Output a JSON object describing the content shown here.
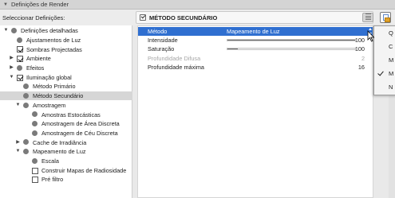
{
  "window": {
    "title": "Definições de Render"
  },
  "selector": {
    "label": "Seleccionar Definições:",
    "value": "MÉTODO SECUNDÁRIO"
  },
  "tree": {
    "items": [
      {
        "label": "Definições detalhadas",
        "twisty": "▼",
        "marker": "bullet",
        "level": 0
      },
      {
        "label": "Ajustamentos de Luz",
        "twisty": "",
        "marker": "bullet",
        "level": 1
      },
      {
        "label": "Sombras Projectadas",
        "twisty": "",
        "marker": "checkbox-on",
        "level": 1
      },
      {
        "label": "Ambiente",
        "twisty": "▶",
        "marker": "checkbox-on",
        "level": 1
      },
      {
        "label": "Efeitos",
        "twisty": "▶",
        "marker": "bullet",
        "level": 1
      },
      {
        "label": "Iluminação global",
        "twisty": "▼",
        "marker": "checkbox-on",
        "level": 1
      },
      {
        "label": "Método Primário",
        "twisty": "",
        "marker": "bullet",
        "level": 2
      },
      {
        "label": "Método Secundário",
        "twisty": "",
        "marker": "bullet",
        "level": 2,
        "selected": true
      },
      {
        "label": "Amostragem",
        "twisty": "▼",
        "marker": "bullet",
        "level": 2
      },
      {
        "label": "Amostras Estocásticas",
        "twisty": "",
        "marker": "bullet",
        "level": 3
      },
      {
        "label": "Amostragem de Área Discreta",
        "twisty": "",
        "marker": "bullet",
        "level": 3
      },
      {
        "label": "Amostragem de Céu Discreta",
        "twisty": "",
        "marker": "bullet",
        "level": 3
      },
      {
        "label": "Cache de Irradiância",
        "twisty": "▶",
        "marker": "bullet",
        "level": 2
      },
      {
        "label": "Mapeamento de Luz",
        "twisty": "▼",
        "marker": "bullet",
        "level": 2
      },
      {
        "label": "Escala",
        "twisty": "",
        "marker": "bullet",
        "level": 3
      },
      {
        "label": "Construir Mapas de Radiosidade",
        "twisty": "",
        "marker": "checkbox-off",
        "level": 3
      },
      {
        "label": "Pré filtro",
        "twisty": "",
        "marker": "checkbox-off",
        "level": 3
      }
    ]
  },
  "properties": [
    {
      "label": "Método",
      "value": "Mapeamento de Luz",
      "highlighted": true
    },
    {
      "label": "Intensidade",
      "value": "100",
      "slider": 1.0
    },
    {
      "label": "Saturação",
      "value": "100",
      "slider": 0.08
    },
    {
      "label": "Profundidade Difusa",
      "value": "2",
      "dim": true
    },
    {
      "label": "Profundidade máxima",
      "value": "16"
    }
  ],
  "popup": {
    "items": [
      {
        "label": "Q",
        "checked": false
      },
      {
        "label": "C",
        "checked": false
      },
      {
        "label": "M",
        "checked": false
      },
      {
        "label": "M",
        "checked": true
      },
      {
        "label": "N",
        "checked": false
      }
    ]
  }
}
